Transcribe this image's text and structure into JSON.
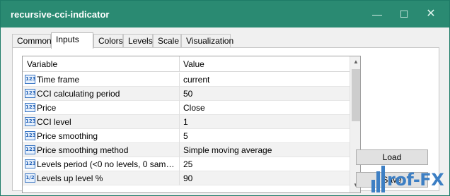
{
  "window": {
    "title": "recursive-cci-indicator",
    "minimize_glyph": "—",
    "maximize_glyph": "☐",
    "close_glyph": "✕"
  },
  "tabs": [
    {
      "label": "Common",
      "active": false
    },
    {
      "label": "Inputs",
      "active": true
    },
    {
      "label": "Colors",
      "active": false
    },
    {
      "label": "Levels",
      "active": false
    },
    {
      "label": "Scale",
      "active": false
    },
    {
      "label": "Visualization",
      "active": false
    }
  ],
  "grid": {
    "header_variable": "Variable",
    "header_value": "Value",
    "rows": [
      {
        "icon": "123",
        "variable": "Time frame",
        "value": "current"
      },
      {
        "icon": "123",
        "variable": "CCI calculating period",
        "value": "50"
      },
      {
        "icon": "123",
        "variable": "Price",
        "value": "Close"
      },
      {
        "icon": "123",
        "variable": "CCI level",
        "value": "1"
      },
      {
        "icon": "123",
        "variable": "Price smoothing",
        "value": "5"
      },
      {
        "icon": "123",
        "variable": "Price smoothing method",
        "value": "Simple moving average"
      },
      {
        "icon": "123",
        "variable": "Levels period (<0 no levels, 0 same as...",
        "value": "25"
      },
      {
        "icon": "1/2",
        "variable": "Levels up level %",
        "value": "90"
      }
    ]
  },
  "scrollbar": {
    "up_glyph": "▲",
    "down_glyph": "▼"
  },
  "buttons": {
    "load": "Load",
    "save": "Save"
  },
  "watermark": {
    "text": "rof-FX"
  },
  "colors": {
    "titlebar": "#2a8a72",
    "brand": "#3d7fc4"
  }
}
